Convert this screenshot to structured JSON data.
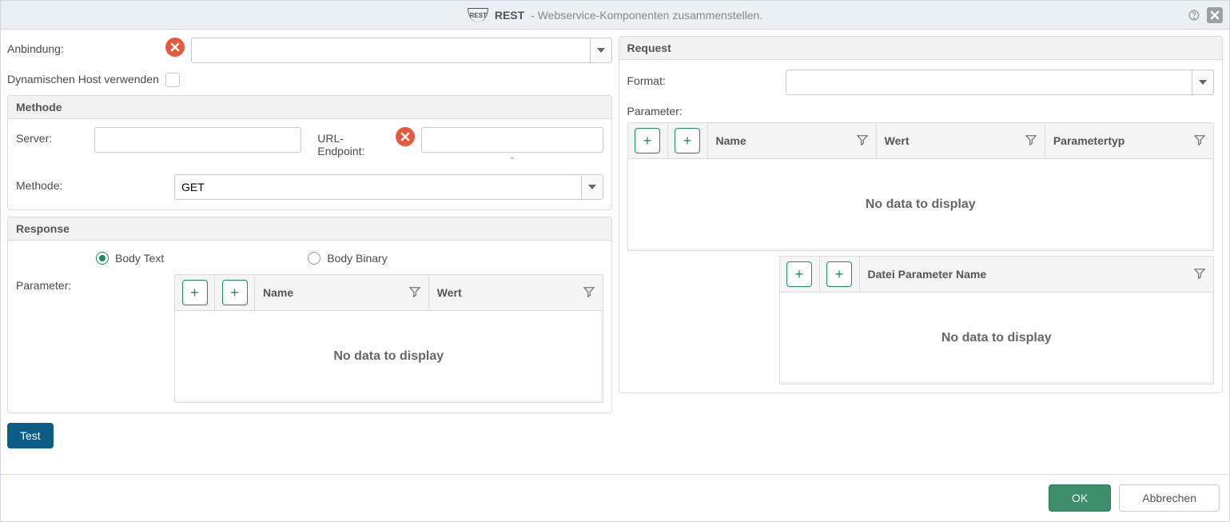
{
  "window": {
    "title": "REST",
    "subtitle": "- Webservice-Komponenten zusammenstellen."
  },
  "left": {
    "anbindung_label": "Anbindung:",
    "anbindung_value": "",
    "dynhost_label": "Dynamischen Host verwenden",
    "dynhost_checked": false,
    "methode_panel": "Methode",
    "server_label": "Server:",
    "server_value": "",
    "endpoint_label": "URL-Endpoint:",
    "endpoint_value": "",
    "methode_label": "Methode:",
    "methode_value": "GET",
    "response_panel": "Response",
    "radio_body_text": "Body Text",
    "radio_body_binary": "Body Binary",
    "radio_selected": "text",
    "param_label": "Parameter:",
    "grid": {
      "col_name": "Name",
      "col_wert": "Wert",
      "empty": "No data to display",
      "rows": []
    },
    "test_btn": "Test"
  },
  "right": {
    "request_panel": "Request",
    "format_label": "Format:",
    "format_value": "",
    "param_label": "Parameter:",
    "grid1": {
      "col_name": "Name",
      "col_wert": "Wert",
      "col_type": "Parametertyp",
      "empty": "No data to display",
      "rows": []
    },
    "grid2": {
      "col_file": "Datei Parameter Name",
      "empty": "No data to display",
      "rows": []
    }
  },
  "footer": {
    "ok": "OK",
    "cancel": "Abbrechen"
  },
  "icons": {
    "plus": "+"
  }
}
